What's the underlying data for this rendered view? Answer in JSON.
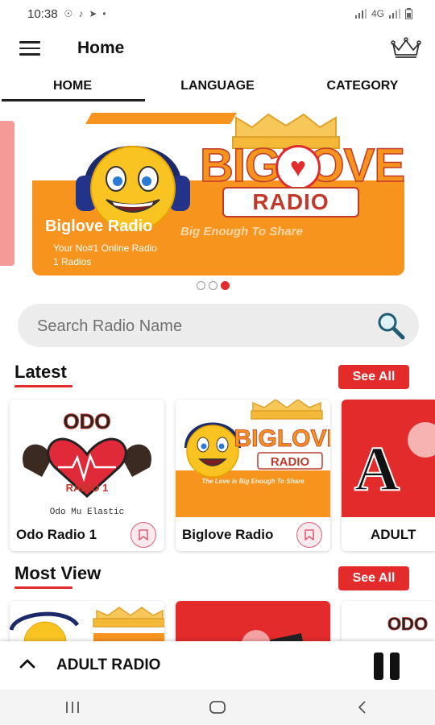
{
  "status": {
    "time": "10:38",
    "left_icons": [
      "whatsapp-icon",
      "tiktok-icon",
      "telegram-icon",
      "dot-icon"
    ],
    "right_text": "4G"
  },
  "app_bar": {
    "title": "Home",
    "menu_icon": "hamburger-icon",
    "premium_icon": "crown-icon"
  },
  "tabs": [
    {
      "label": "HOME",
      "active": true
    },
    {
      "label": "LANGUAGE",
      "active": false
    },
    {
      "label": "CATEGORY",
      "active": false
    }
  ],
  "banner": {
    "title": "Biglove Radio",
    "subtitle": "Your No#1 Online Radio",
    "count": "1 Radios",
    "logo_word": "BIGLOVE",
    "logo_radio": "RADIO",
    "logo_tagline": "Big Enough To Share",
    "slide_count": 3,
    "active_slide": 3
  },
  "search": {
    "placeholder": "Search Radio Name"
  },
  "sections": {
    "latest": {
      "title": "Latest",
      "see_all": "See All",
      "items": [
        {
          "name": "Odo Radio 1",
          "art_text": "ODO",
          "art_sub": "RADIO 1",
          "art_caption": "Odo Mu Elastic"
        },
        {
          "name": "Biglove Radio",
          "art_word": "BIGLOVE",
          "art_radio": "RADIO",
          "art_caption": "The Love is Big Enough To Share"
        },
        {
          "name": "ADULT",
          "art_text": "A"
        }
      ]
    },
    "most_view": {
      "title": "Most View",
      "see_all": "See All"
    }
  },
  "player": {
    "title": "ADULT RADIO",
    "state": "playing"
  },
  "colors": {
    "accent": "#e32b2b",
    "orange": "#f7941d",
    "search_bg": "#ececec"
  }
}
